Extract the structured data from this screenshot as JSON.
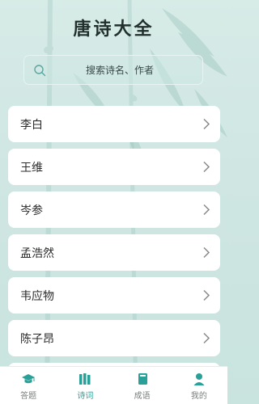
{
  "header": {
    "title": "唐诗大全"
  },
  "search": {
    "placeholder": "搜索诗名、作者"
  },
  "poets": [
    {
      "name": "李白"
    },
    {
      "name": "王维"
    },
    {
      "name": "岑参"
    },
    {
      "name": "孟浩然"
    },
    {
      "name": "韦应物"
    },
    {
      "name": "陈子昂"
    }
  ],
  "tabbar": {
    "active": "诗词",
    "items": [
      {
        "label": "答题",
        "icon": "graduation-cap-icon"
      },
      {
        "label": "诗词",
        "icon": "books-icon"
      },
      {
        "label": "成语",
        "icon": "book-icon"
      },
      {
        "label": "我的",
        "icon": "user-icon"
      }
    ]
  },
  "colors": {
    "background": "#d7ebe7",
    "accent": "#2aa198",
    "card": "#ffffff",
    "text": "#2b2b2b"
  }
}
